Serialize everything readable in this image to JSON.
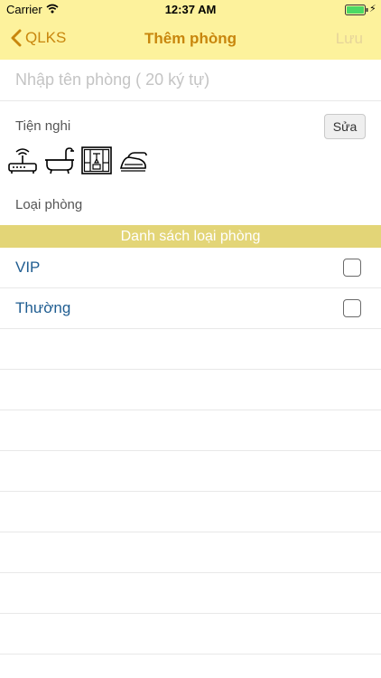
{
  "status_bar": {
    "carrier": "Carrier",
    "time": "12:37 AM"
  },
  "nav": {
    "back_label": "QLKS",
    "title": "Thêm phòng",
    "save_label": "Lưu"
  },
  "room_name": {
    "placeholder": "Nhập tên phòng ( 20 ký tự)",
    "value": ""
  },
  "amenities": {
    "label": "Tiện nghi",
    "edit_label": "Sửa",
    "icons": [
      "wifi-router-icon",
      "bathtub-icon",
      "wardrobe-icon",
      "iron-icon"
    ]
  },
  "room_type": {
    "label": "Loại phòng",
    "list_header": "Danh sách loại phòng",
    "options": [
      {
        "label": "VIP",
        "checked": false
      },
      {
        "label": "Thường",
        "checked": false
      }
    ]
  },
  "colors": {
    "nav_background": "#fdf29c",
    "accent": "#c8860d",
    "save_disabled": "#e6d49a",
    "section_header": "#e3d577",
    "row_text": "#1f5d91"
  }
}
